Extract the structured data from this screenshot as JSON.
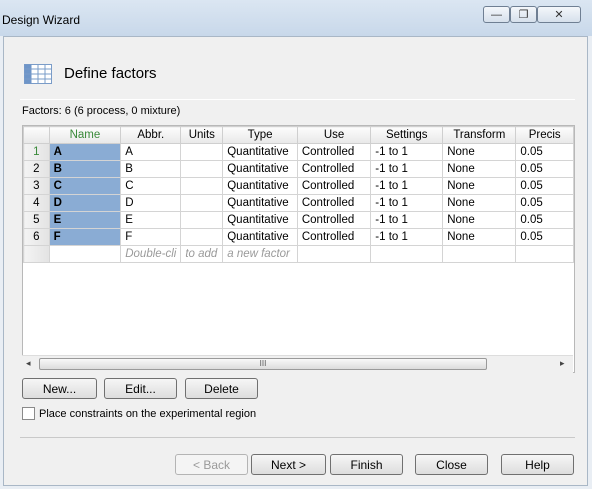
{
  "window": {
    "title": "Design Wizard"
  },
  "header": {
    "title": "Define factors"
  },
  "factors_summary": "Factors: 6 (6 process, 0 mixture)",
  "grid": {
    "columns": [
      "Name",
      "Abbr.",
      "Units",
      "Type",
      "Use",
      "Settings",
      "Transform",
      "Precis"
    ],
    "rows": [
      {
        "num": "1",
        "name": "A",
        "abbr": "A",
        "units": "",
        "type": "Quantitative",
        "use": "Controlled",
        "settings": "-1 to 1",
        "transform": "None",
        "precision": "0.05"
      },
      {
        "num": "2",
        "name": "B",
        "abbr": "B",
        "units": "",
        "type": "Quantitative",
        "use": "Controlled",
        "settings": "-1 to 1",
        "transform": "None",
        "precision": "0.05"
      },
      {
        "num": "3",
        "name": "C",
        "abbr": "C",
        "units": "",
        "type": "Quantitative",
        "use": "Controlled",
        "settings": "-1 to 1",
        "transform": "None",
        "precision": "0.05"
      },
      {
        "num": "4",
        "name": "D",
        "abbr": "D",
        "units": "",
        "type": "Quantitative",
        "use": "Controlled",
        "settings": "-1 to 1",
        "transform": "None",
        "precision": "0.05"
      },
      {
        "num": "5",
        "name": "E",
        "abbr": "E",
        "units": "",
        "type": "Quantitative",
        "use": "Controlled",
        "settings": "-1 to 1",
        "transform": "None",
        "precision": "0.05"
      },
      {
        "num": "6",
        "name": "F",
        "abbr": "F",
        "units": "",
        "type": "Quantitative",
        "use": "Controlled",
        "settings": "-1 to 1",
        "transform": "None",
        "precision": "0.05"
      }
    ],
    "new_row_hint": [
      "Double-cli",
      "to add",
      "a new factor"
    ]
  },
  "scrollbar": {
    "left_arrow": "◂",
    "right_arrow": "▸",
    "grip": "III"
  },
  "buttons": {
    "new": "New...",
    "edit": "Edit...",
    "delete": "Delete"
  },
  "constraint_checkbox": {
    "label": "Place constraints on the experimental region",
    "checked": false
  },
  "footer": {
    "back": "< Back",
    "next": "Next >",
    "finish": "Finish",
    "close": "Close",
    "help": "Help"
  }
}
